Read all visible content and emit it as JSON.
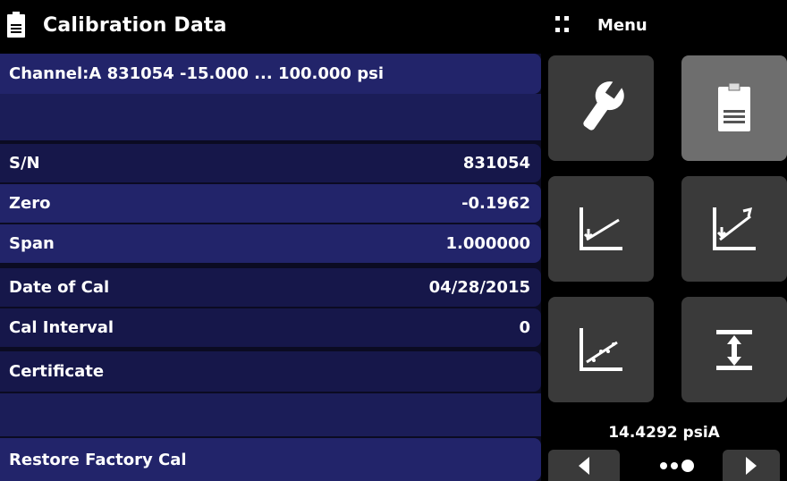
{
  "header": {
    "title": "Calibration Data",
    "icon": "document-icon"
  },
  "menu": {
    "label": "Menu",
    "icon": "grid-dots-icon"
  },
  "channel": {
    "label": "Channel:A 831054  -15.000 ... 100.000 psi"
  },
  "rows": [
    {
      "label": "S/N",
      "value": "831054"
    },
    {
      "label": "Zero",
      "value": "-0.1962"
    },
    {
      "label": "Span",
      "value": "1.000000"
    },
    {
      "label": "Date of Cal",
      "value": "04/28/2015"
    },
    {
      "label": "Cal Interval",
      "value": "0"
    },
    {
      "label": "Certificate",
      "value": ""
    }
  ],
  "restore": {
    "label": "Restore Factory Cal"
  },
  "tiles": [
    {
      "name": "wrench-icon",
      "active": false
    },
    {
      "name": "document-icon",
      "active": true
    },
    {
      "name": "zero-adjust-chart-icon",
      "active": false
    },
    {
      "name": "span-adjust-chart-icon",
      "active": false
    },
    {
      "name": "linearity-chart-icon",
      "active": false
    },
    {
      "name": "range-limit-icon",
      "active": false
    }
  ],
  "status": {
    "pressure": "14.4292 psiA"
  },
  "pager": {
    "pages": 3,
    "current": 3
  },
  "colors": {
    "panel": "#0b0b22",
    "row_dark": "#16174a",
    "row_light": "#22246a",
    "tile": "#3a3a3a",
    "tile_active": "#6e6e6e"
  }
}
